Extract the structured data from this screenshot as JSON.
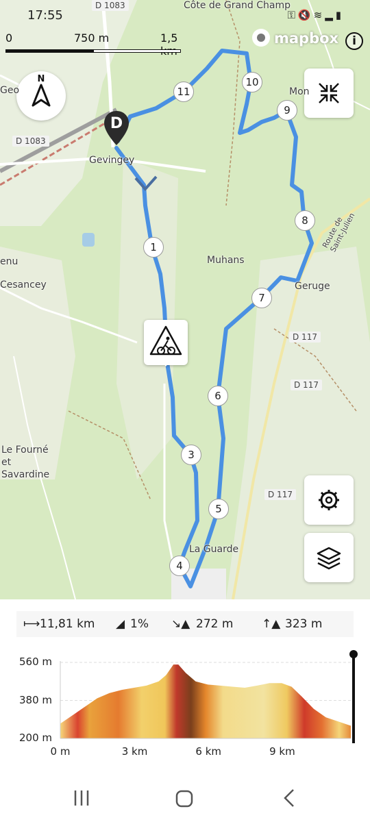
{
  "status_bar": {
    "time": "17:55",
    "icons": [
      "key-icon",
      "mute-icon",
      "wifi-icon",
      "signal-icon",
      "battery-icon"
    ]
  },
  "map": {
    "scale": {
      "zero": "0",
      "mid": "750 m",
      "end": "1,5 km"
    },
    "attribution": "mapbox",
    "places": [
      "Côte de Grand Champ",
      "Gevingey",
      "Cesancey",
      "Muhans",
      "Geruge",
      "Le Fourné et Savardine",
      "La Guarde",
      "Route de Saint-Julien",
      "Geo",
      "Mon",
      "enu"
    ],
    "roads": [
      "D 1083",
      "D 1083",
      "D 117",
      "D 117",
      "D 117"
    ],
    "start_marker": "D",
    "waypoints": [
      "1",
      "3",
      "4",
      "5",
      "6",
      "7",
      "8",
      "9",
      "10",
      "11"
    ],
    "route_color": "#4a90e2"
  },
  "controls": {
    "compass_letter": "N",
    "info_label": "i"
  },
  "stats": {
    "distance": "11,81 km",
    "grade": "1%",
    "descent": "272 m",
    "ascent": "323 m"
  },
  "elevation_profile": {
    "y_labels": [
      "560 m",
      "380 m",
      "200 m"
    ],
    "x_labels": [
      "0 m",
      "3 km",
      "6 km",
      "9 km"
    ]
  },
  "chart_data": {
    "type": "area",
    "title": "",
    "xlabel": "",
    "ylabel": "",
    "ylim": [
      200,
      560
    ],
    "xlim": [
      0,
      11.81
    ],
    "x": [
      0,
      0.5,
      1,
      1.5,
      2,
      2.5,
      3,
      3.5,
      4,
      4.3,
      4.6,
      4.8,
      5.1,
      5.5,
      6,
      6.5,
      7,
      7.5,
      8,
      8.5,
      9,
      9.4,
      9.8,
      10.3,
      10.8,
      11.3,
      11.81
    ],
    "y": [
      270,
      310,
      350,
      390,
      415,
      430,
      440,
      450,
      470,
      500,
      550,
      550,
      510,
      470,
      455,
      450,
      445,
      440,
      450,
      462,
      462,
      445,
      400,
      340,
      300,
      280,
      260
    ],
    "x_unit": "km",
    "y_unit": "m"
  }
}
